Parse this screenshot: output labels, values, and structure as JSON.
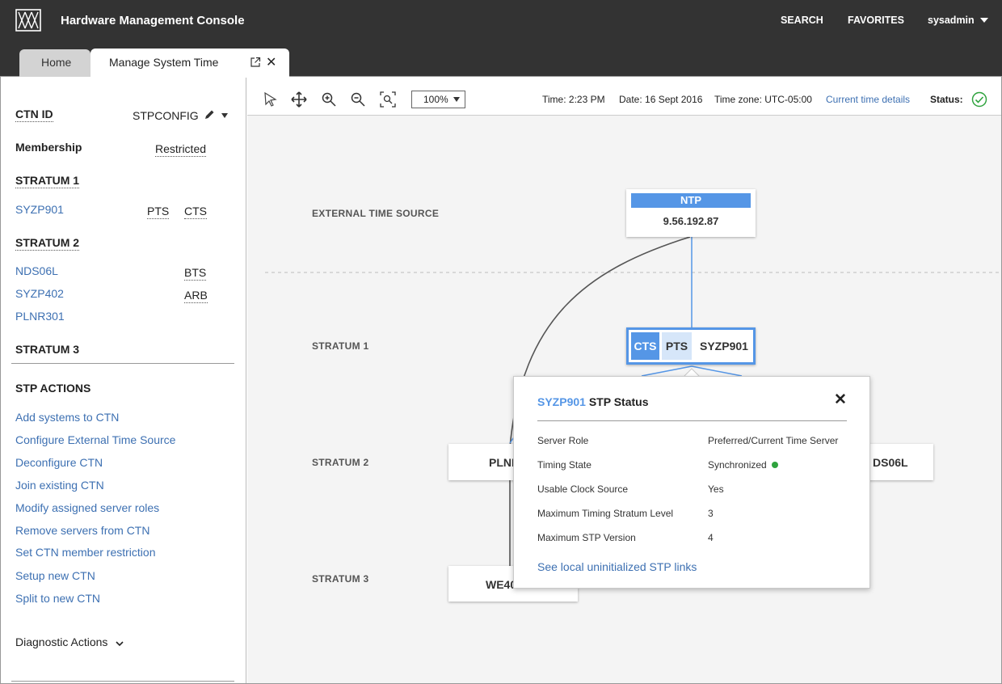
{
  "header": {
    "app_title": "Hardware Management Console",
    "nav": {
      "search": "SEARCH",
      "favorites": "FAVORITES",
      "user": "sysadmin"
    }
  },
  "tabs": {
    "home": "Home",
    "active": "Manage System Time"
  },
  "sidebar": {
    "ctn_id_label": "CTN ID",
    "ctn_id_value": "STPCONFIG",
    "membership_label": "Membership",
    "membership_value": "Restricted",
    "stratum1_label": "STRATUM 1",
    "stratum1": [
      {
        "name": "SYZP901",
        "role1": "PTS",
        "role2": "CTS"
      }
    ],
    "stratum2_label": "STRATUM 2",
    "stratum2": [
      {
        "name": "NDS06L",
        "role": "BTS"
      },
      {
        "name": "SYZP402",
        "role": "ARB"
      },
      {
        "name": "PLNR301",
        "role": ""
      }
    ],
    "stratum3_label": "STRATUM 3",
    "actions_title": "STP ACTIONS",
    "actions": [
      "Add systems to CTN",
      "Configure External Time Source",
      "Deconfigure CTN",
      "Join existing CTN",
      "Modify assigned server roles",
      "Remove servers from CTN",
      "Set CTN member restriction",
      "Setup new CTN",
      "Split to new CTN"
    ],
    "diagnostic": "Diagnostic Actions"
  },
  "toolbar": {
    "zoom": "100%",
    "time": "Time: 2:23 PM",
    "date": "Date: 16 Sept 2016",
    "timezone": "Time zone: UTC-05:00",
    "details_link": "Current time details",
    "status_label": "Status:"
  },
  "canvas": {
    "labels": {
      "external": "EXTERNAL TIME SOURCE",
      "stratum1": "STRATUM 1",
      "stratum2": "STRATUM 2",
      "stratum3": "STRATUM 3"
    },
    "ntp": {
      "header": "NTP",
      "ip": "9.56.192.87"
    },
    "s1_node": {
      "badge1": "CTS",
      "badge2": "PTS",
      "name": "SYZP901"
    },
    "s2_left": "PLNR",
    "s2_right": "DS06L",
    "s3_node": "WE40"
  },
  "popup": {
    "system": "SYZP901",
    "title_suffix": " STP Status",
    "rows": [
      {
        "key": "Server Role",
        "value": "Preferred/Current Time Server"
      },
      {
        "key": "Timing State",
        "value": "Synchronized"
      },
      {
        "key": "Usable Clock Source",
        "value": "Yes"
      },
      {
        "key": "Maximum Timing Stratum Level",
        "value": "3"
      },
      {
        "key": "Maximum STP Version",
        "value": "4"
      }
    ],
    "link": "See local uninitialized STP links"
  },
  "colors": {
    "accent": "#5596e6",
    "link": "#3d70b2",
    "header_bg": "#333333",
    "status_ok": "#2fa33e"
  },
  "icons": [
    "logo-icon",
    "pencil-icon",
    "caret-down-icon",
    "open-external-icon",
    "close-icon",
    "pointer-icon",
    "move-icon",
    "zoom-in-icon",
    "zoom-out-icon",
    "fit-to-screen-icon",
    "status-ok-icon",
    "chevron-down-icon"
  ]
}
